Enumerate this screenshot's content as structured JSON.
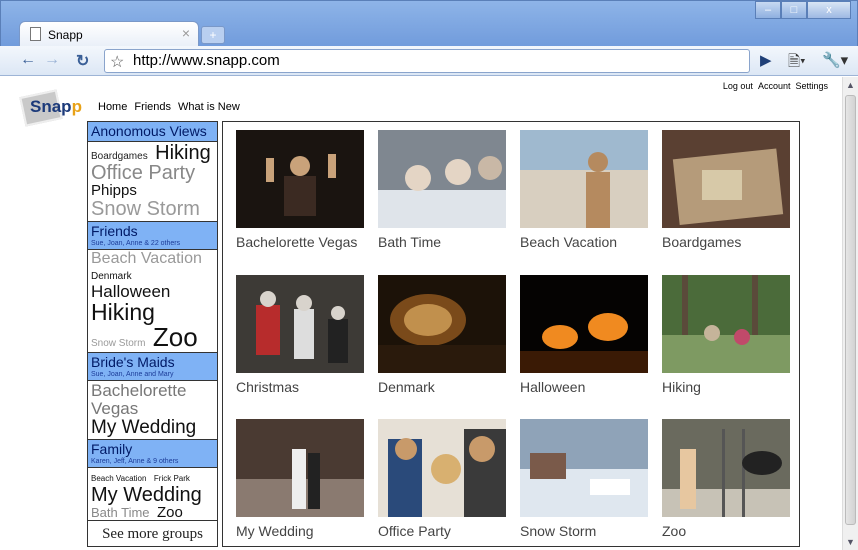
{
  "browser": {
    "tab_title": "Snapp",
    "tab_close": "×",
    "new_tab": "+",
    "url": "http://www.snapp.com",
    "window_buttons": {
      "minimize": "–",
      "maximize": "□",
      "close": "x"
    }
  },
  "logo": {
    "main": "Snap",
    "accent": "p"
  },
  "topnav": [
    "Home",
    "Friends",
    "What is New"
  ],
  "account_nav": [
    "Log out",
    "Account",
    "Settings"
  ],
  "sidebar": {
    "groups": [
      {
        "title": "Anonomous Views",
        "subtitle": "",
        "tags": [
          {
            "text": "Boardgames",
            "size": 10,
            "color": "#222"
          },
          {
            "text": "Hiking",
            "size": 20,
            "color": "#111"
          },
          {
            "text": "Office Party",
            "size": 20,
            "color": "#888"
          },
          {
            "text": "Phipps",
            "size": 15,
            "color": "#111"
          },
          {
            "text": "Snow Storm",
            "size": 20,
            "color": "#999"
          }
        ]
      },
      {
        "title": "Friends",
        "subtitle": "Sue, Joan, Anne & 22 others",
        "tags": [
          {
            "text": "Beach Vacation",
            "size": 16,
            "color": "#999"
          },
          {
            "text": "Denmark",
            "size": 10,
            "color": "#111"
          },
          {
            "text": "Halloween",
            "size": 17,
            "color": "#111"
          },
          {
            "text": "Hiking",
            "size": 23,
            "color": "#111"
          },
          {
            "text": "Snow Storm",
            "size": 10,
            "color": "#999"
          },
          {
            "text": "Zoo",
            "size": 26,
            "color": "#111"
          }
        ]
      },
      {
        "title": "Bride's Maids",
        "subtitle": "Sue, Joan, Anne and Mary",
        "tags": [
          {
            "text": "Bachelorette",
            "size": 17,
            "color": "#777"
          },
          {
            "text": "Vegas",
            "size": 17,
            "color": "#777"
          },
          {
            "text": "My Wedding",
            "size": 19,
            "color": "#111"
          }
        ]
      },
      {
        "title": "Family",
        "subtitle": "Karen, Jeff, Anne & 9 others",
        "tags": [
          {
            "text": "Beach Vacation",
            "size": 8,
            "color": "#111"
          },
          {
            "text": "Frick Park",
            "size": 8,
            "color": "#111"
          },
          {
            "text": "My Wedding",
            "size": 20,
            "color": "#111"
          },
          {
            "text": "Bath Time",
            "size": 13,
            "color": "#888"
          },
          {
            "text": "Zoo",
            "size": 15,
            "color": "#111"
          }
        ]
      }
    ],
    "see_more": "See more groups"
  },
  "gallery": [
    {
      "caption": "Bachelorette Vegas",
      "scene": "party",
      "colors": [
        "#1a1410",
        "#3b2a22",
        "#c9a27a"
      ]
    },
    {
      "caption": "Bath Time",
      "scene": "bath",
      "colors": [
        "#7f8790",
        "#c9b8a6",
        "#e4d5c5"
      ]
    },
    {
      "caption": "Beach Vacation",
      "scene": "beach",
      "colors": [
        "#9fb9cf",
        "#d8cfc0",
        "#b58a5f"
      ]
    },
    {
      "caption": "Boardgames",
      "scene": "board",
      "colors": [
        "#5a4032",
        "#b59b7a",
        "#d7c9a8"
      ]
    },
    {
      "caption": "Christmas",
      "scene": "christmas",
      "colors": [
        "#3d3a36",
        "#b72c2c",
        "#d8d3cc"
      ]
    },
    {
      "caption": "Denmark",
      "scene": "night",
      "colors": [
        "#1c1208",
        "#7a4a1a",
        "#f0c070"
      ]
    },
    {
      "caption": "Halloween",
      "scene": "pumpkins",
      "colors": [
        "#050302",
        "#3a1a05",
        "#f08a20"
      ]
    },
    {
      "caption": "Hiking",
      "scene": "forest",
      "colors": [
        "#4b6b3a",
        "#7e9a62",
        "#c5b49a"
      ]
    },
    {
      "caption": "My Wedding",
      "scene": "wedding",
      "colors": [
        "#4a3a32",
        "#8a7a70",
        "#eeeeee"
      ]
    },
    {
      "caption": "Office Party",
      "scene": "office",
      "colors": [
        "#2a4a7a",
        "#c89a6a",
        "#e6e0d6"
      ]
    },
    {
      "caption": "Snow Storm",
      "scene": "snow",
      "colors": [
        "#8fa3b8",
        "#dfe7ef",
        "#ffffff"
      ]
    },
    {
      "caption": "Zoo",
      "scene": "zoo",
      "colors": [
        "#6a6a5e",
        "#c7c2b6",
        "#e7c7a0"
      ]
    }
  ]
}
